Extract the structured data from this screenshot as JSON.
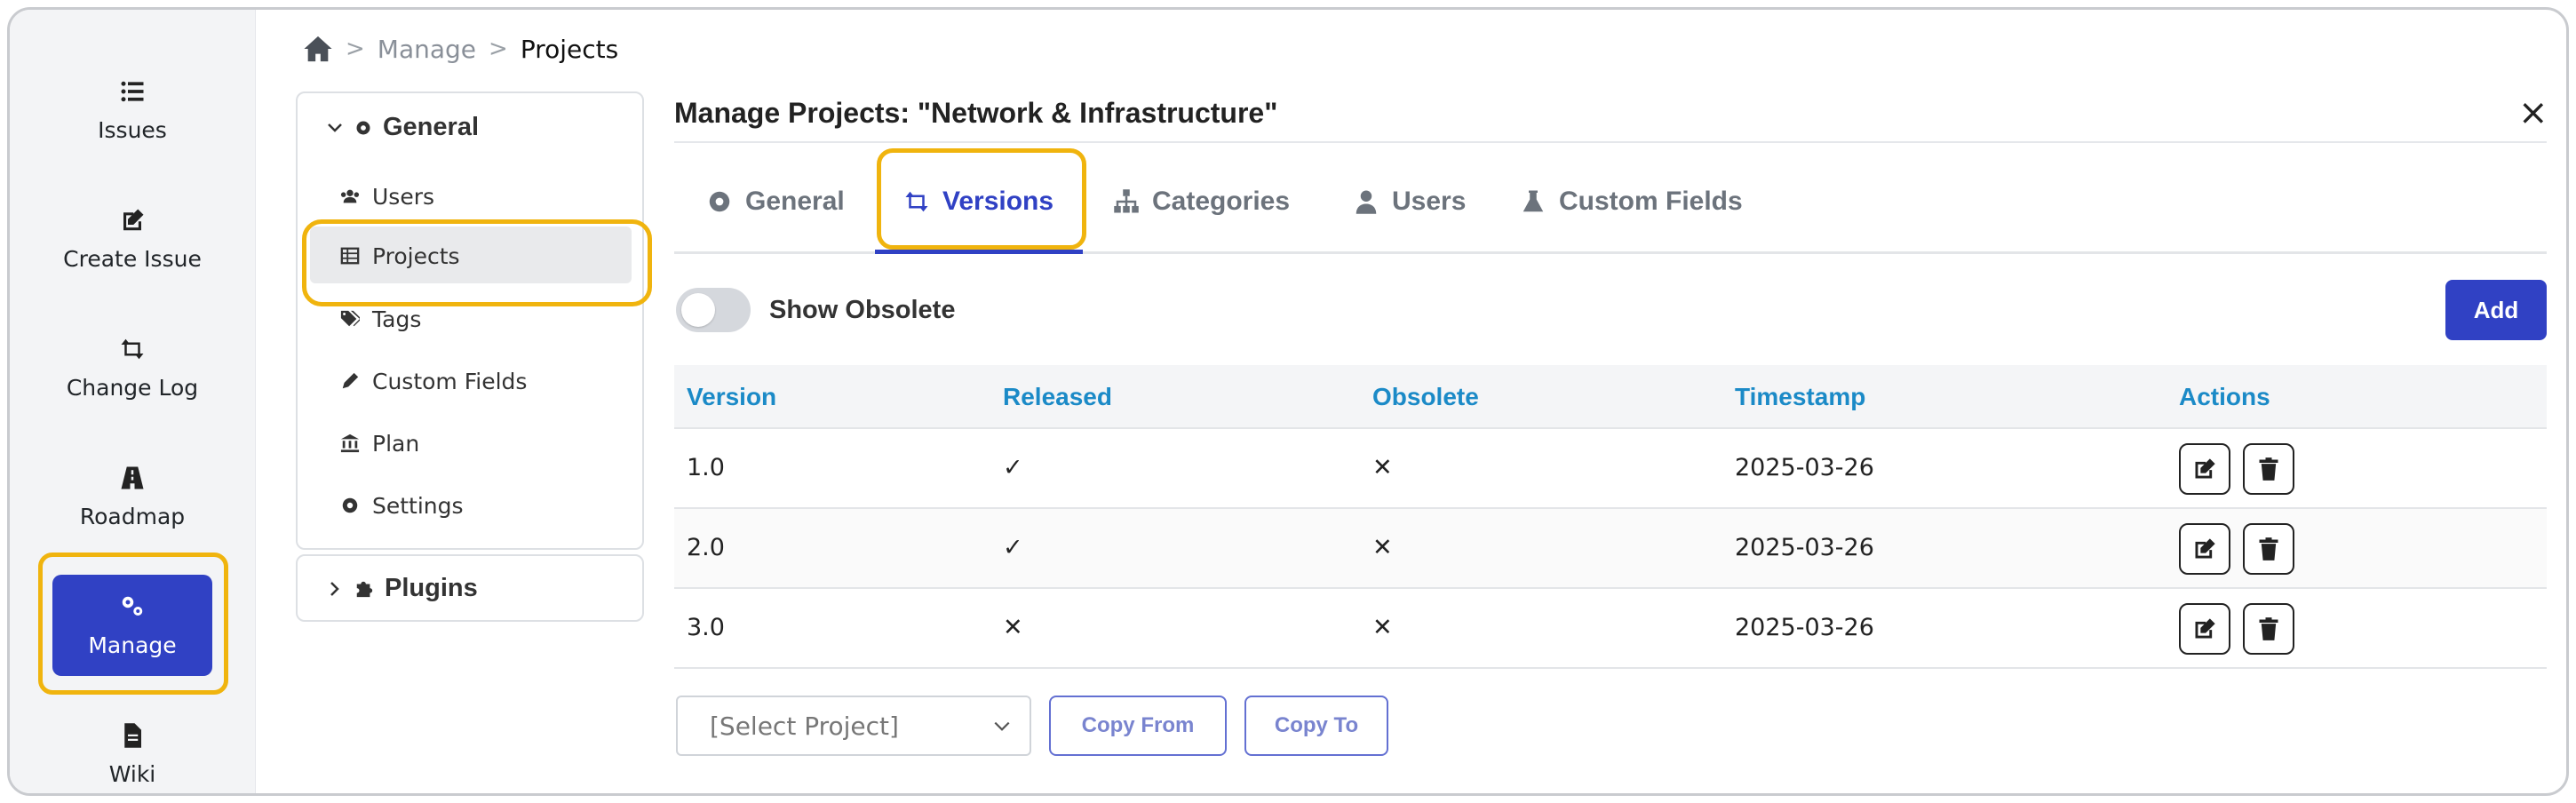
{
  "breadcrumb": {
    "home_icon": "home-icon",
    "parent": "Manage",
    "current": "Projects"
  },
  "leftnav": {
    "items": [
      {
        "label": "Issues",
        "icon": "list-icon"
      },
      {
        "label": "Create Issue",
        "icon": "edit-icon"
      },
      {
        "label": "Change Log",
        "icon": "retweet-icon"
      },
      {
        "label": "Roadmap",
        "icon": "road-icon"
      },
      {
        "label": "Manage",
        "icon": "cogs-icon",
        "active": true
      },
      {
        "label": "Wiki",
        "icon": "file-icon"
      }
    ]
  },
  "admin_menu": {
    "general_title": "General",
    "items": [
      {
        "label": "Users",
        "icon": "users-icon"
      },
      {
        "label": "Projects",
        "icon": "table-icon",
        "active": true
      },
      {
        "label": "Tags",
        "icon": "tags-icon"
      },
      {
        "label": "Custom Fields",
        "icon": "pencil-icon"
      },
      {
        "label": "Plan",
        "icon": "bank-icon"
      },
      {
        "label": "Settings",
        "icon": "gear-icon"
      }
    ],
    "plugins_title": "Plugins"
  },
  "main": {
    "title": "Manage Projects: \"Network & Infrastructure\"",
    "close": "×",
    "tabs": [
      {
        "label": "General",
        "icon": "gear-icon"
      },
      {
        "label": "Versions",
        "icon": "retweet-icon",
        "active": true
      },
      {
        "label": "Categories",
        "icon": "sitemap-icon"
      },
      {
        "label": "Users",
        "icon": "user-icon"
      },
      {
        "label": "Custom Fields",
        "icon": "flask-icon"
      }
    ],
    "toggle_label": "Show Obsolete",
    "toggle_on": false,
    "add_label": "Add",
    "table": {
      "headers": [
        "Version",
        "Released",
        "Obsolete",
        "Timestamp",
        "Actions"
      ],
      "rows": [
        {
          "version": "1.0",
          "released": "✓",
          "obsolete": "✕",
          "timestamp": "2025-03-26"
        },
        {
          "version": "2.0",
          "released": "✓",
          "obsolete": "✕",
          "timestamp": "2025-03-26"
        },
        {
          "version": "3.0",
          "released": "✕",
          "obsolete": "✕",
          "timestamp": "2025-03-26"
        }
      ]
    },
    "select_placeholder": "[Select Project]",
    "copy_from_label": "Copy From",
    "copy_to_label": "Copy To"
  },
  "colors": {
    "accent": "#3041c4",
    "highlight": "#f0b40e",
    "header_text": "#1b8ac7"
  }
}
